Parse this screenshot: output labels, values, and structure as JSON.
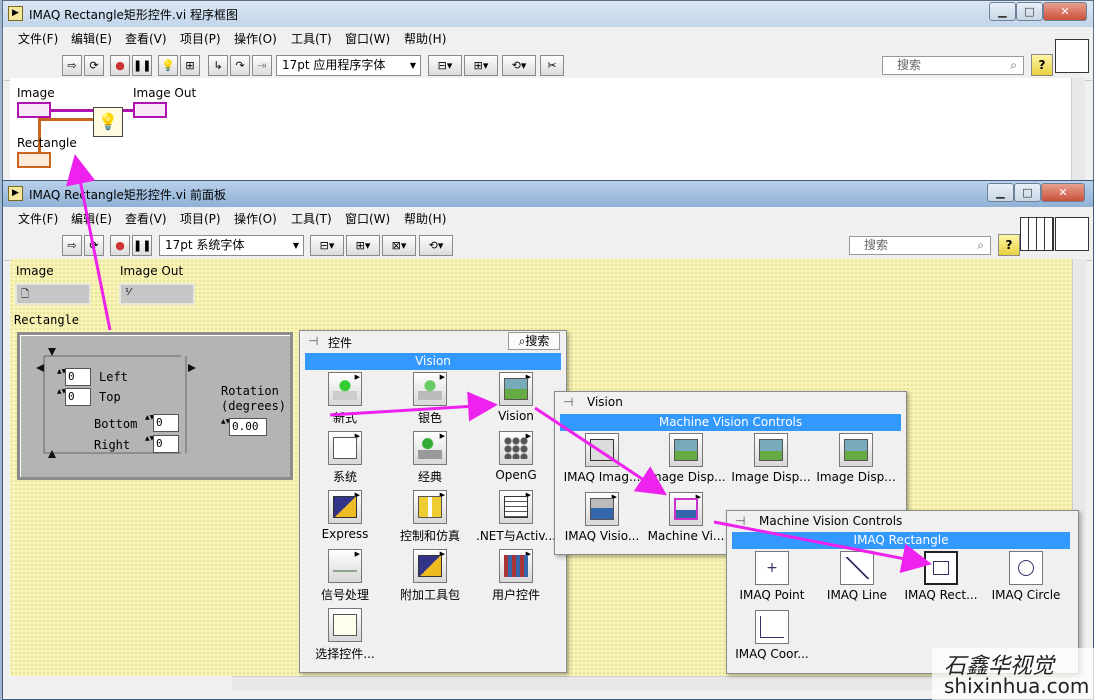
{
  "block_diagram": {
    "title": "IMAQ Rectangle矩形控件.vi 程序框图",
    "menus": [
      "文件(F)",
      "编辑(E)",
      "查看(V)",
      "项目(P)",
      "操作(O)",
      "工具(T)",
      "窗口(W)",
      "帮助(H)"
    ],
    "font": "17pt 应用程序字体",
    "search_placeholder": "搜索",
    "labels": {
      "image": "Image",
      "image_out": "Image Out",
      "rectangle": "Rectangle"
    }
  },
  "front_panel": {
    "title": "IMAQ Rectangle矩形控件.vi 前面板",
    "menus": [
      "文件(F)",
      "编辑(E)",
      "查看(V)",
      "项目(P)",
      "操作(O)",
      "工具(T)",
      "窗口(W)",
      "帮助(H)"
    ],
    "font": "17pt 系统字体",
    "search_placeholder": "搜索",
    "image_label": "Image",
    "image_out_label": "Image Out",
    "rectangle_label": "Rectangle",
    "rect": {
      "left_label": "Left",
      "left_value": "0",
      "top_label": "Top",
      "top_value": "0",
      "bottom_label": "Bottom",
      "bottom_value": "0",
      "right_label": "Right",
      "right_value": "0",
      "rotation_label_1": "Rotation",
      "rotation_label_2": "(degrees)",
      "rotation_value": "0.00"
    }
  },
  "controls_palette": {
    "title": "控件",
    "search": "搜索",
    "section": "Vision",
    "items": [
      "新式",
      "银色",
      "Vision",
      "系统",
      "经典",
      "OpenG",
      "Express",
      "控制和仿真",
      ".NET与Activ...",
      "信号处理",
      "附加工具包",
      "用户控件",
      "选择控件..."
    ]
  },
  "vision_palette": {
    "title": "Vision",
    "section": "Machine Vision Controls",
    "items": [
      "IMAQ Imag...",
      "Image Disp...",
      "Image Disp...",
      "Image Disp...",
      "IMAQ Visio...",
      "Machine Vi..."
    ]
  },
  "mvc_palette": {
    "title": "Machine Vision Controls",
    "section": "IMAQ Rectangle",
    "items": [
      "IMAQ Point",
      "IMAQ Line",
      "IMAQ Rect...",
      "IMAQ Circle",
      "IMAQ Coor..."
    ]
  },
  "window_buttons": {
    "minimize": "▁",
    "maximize": "□",
    "close": "✕"
  },
  "watermark": {
    "cn": "石鑫华视觉",
    "url": "shixinhua.com"
  },
  "colors": {
    "highlight": "#3399ff",
    "wire_image": "#b012b0",
    "wire_cluster": "#c8641e",
    "panel_bg": "#f8f4b8",
    "arrow": "#ee22ee"
  }
}
